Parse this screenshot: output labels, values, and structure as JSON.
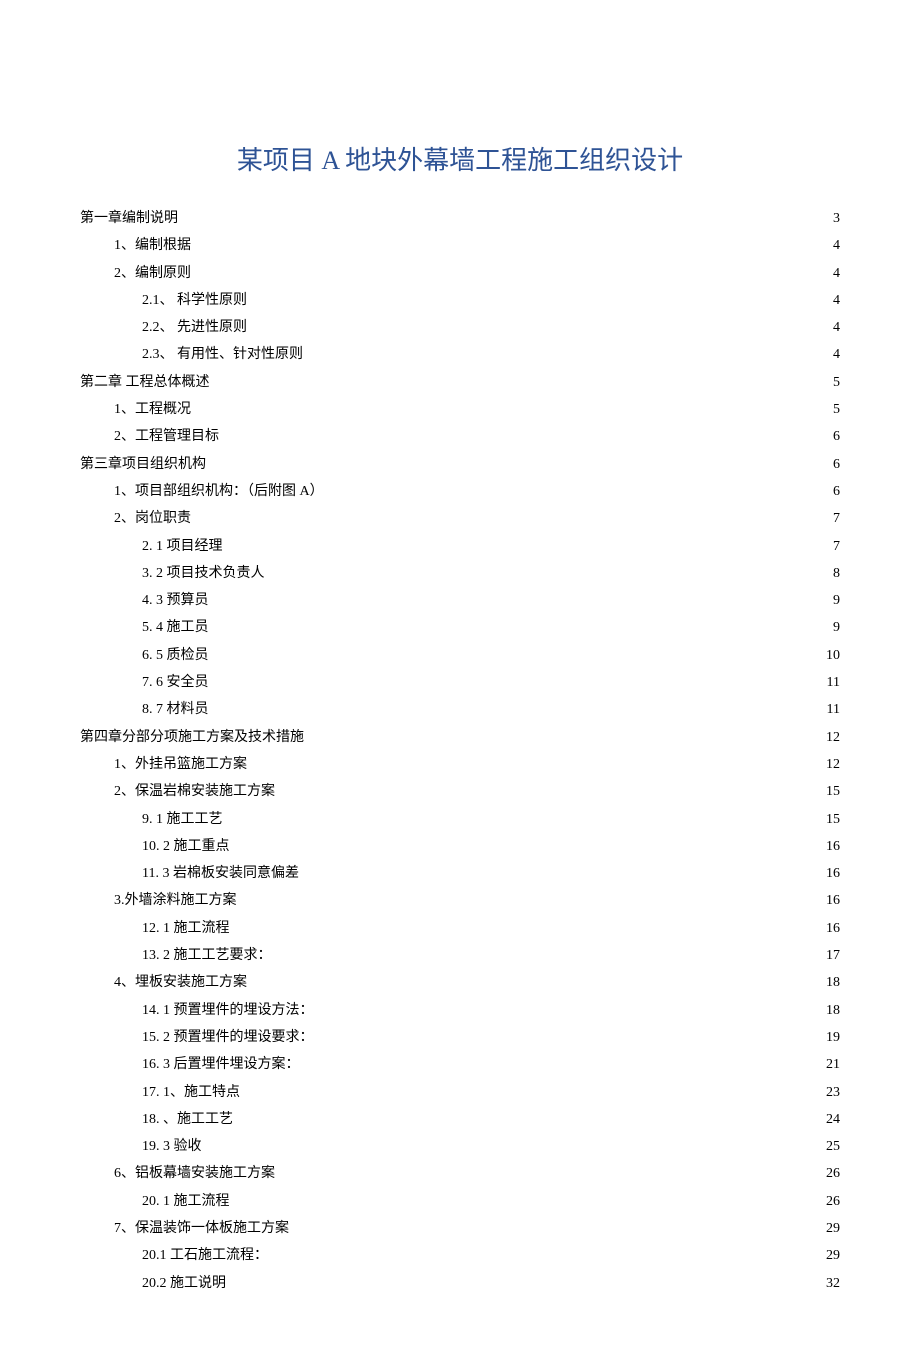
{
  "title": "某项目 A 地块外幕墙工程施工组织设计",
  "toc": [
    {
      "label": "第一章编制说明",
      "page": "3",
      "indent": 0
    },
    {
      "label": "1、编制根据",
      "page": "4",
      "indent": 1
    },
    {
      "label": "2、编制原则",
      "page": "4",
      "indent": 1
    },
    {
      "label": "2.1、  科学性原则",
      "page": "4",
      "indent": 2
    },
    {
      "label": "2.2、  先进性原则",
      "page": "4",
      "indent": 2
    },
    {
      "label": "2.3、  有用性、针对性原则",
      "page": "4",
      "indent": 2
    },
    {
      "label": "第二章   工程总体概述",
      "page": "5",
      "indent": 0
    },
    {
      "label": "1、工程概况",
      "page": "5",
      "indent": 1
    },
    {
      "label": "2、工程管理目标",
      "page": "6",
      "indent": 1
    },
    {
      "label": "第三章项目组织机构",
      "page": "6",
      "indent": 0
    },
    {
      "label": "1、项目部组织机构：（后附图 A）",
      "page": "6",
      "indent": 1
    },
    {
      "label": "2、岗位职责",
      "page": "7",
      "indent": 1
    },
    {
      "label": "2.  1 项目经理",
      "page": "7",
      "indent": 2
    },
    {
      "label": "3.  2 项目技术负责人",
      "page": "8",
      "indent": 2
    },
    {
      "label": "4.  3 预算员",
      "page": "9",
      "indent": 2
    },
    {
      "label": "5.  4 施工员",
      "page": "9",
      "indent": 2
    },
    {
      "label": "6.  5 质检员",
      "page": "10",
      "indent": 2
    },
    {
      "label": "7.  6 安全员",
      "page": "11",
      "indent": 2
    },
    {
      "label": "8.  7 材料员",
      "page": "11",
      "indent": 2
    },
    {
      "label": "第四章分部分项施工方案及技术措施",
      "page": "12",
      "indent": 0
    },
    {
      "label": "1、外挂吊篮施工方案",
      "page": "12",
      "indent": 1
    },
    {
      "label": "2、保温岩棉安装施工方案",
      "page": "15",
      "indent": 1
    },
    {
      "label": "9.  1 施工工艺",
      "page": "15",
      "indent": 2
    },
    {
      "label": "10. 2 施工重点",
      "page": "16",
      "indent": 2
    },
    {
      "label": "11. 3 岩棉板安装同意偏差",
      "page": "16",
      "indent": 2
    },
    {
      "label": "3.外墙涂料施工方案",
      "page": "16",
      "indent": 1
    },
    {
      "label": "12. 1 施工流程",
      "page": "16",
      "indent": 2
    },
    {
      "label": "13. 2 施工工艺要求：",
      "page": "17",
      "indent": 2
    },
    {
      "label": "4、埋板安装施工方案",
      "page": "18",
      "indent": 1
    },
    {
      "label": "14. 1 预置埋件的埋设方法：",
      "page": "18",
      "indent": 2
    },
    {
      "label": "15. 2 预置埋件的埋设要求：",
      "page": "19",
      "indent": 2
    },
    {
      "label": "16. 3 后置埋件埋设方案：",
      "page": "21",
      "indent": 2
    },
    {
      "label": "17. 1、施工特点",
      "page": "23",
      "indent": 2
    },
    {
      "label": "18.   、施工工艺",
      "page": "24",
      "indent": 2
    },
    {
      "label": "19. 3 验收",
      "page": "25",
      "indent": 2
    },
    {
      "label": "6、铝板幕墙安装施工方案",
      "page": "26",
      "indent": 1
    },
    {
      "label": "20. 1 施工流程",
      "page": "26",
      "indent": 2
    },
    {
      "label": "7、保温装饰一体板施工方案",
      "page": "29",
      "indent": 1
    },
    {
      "label": "20.1    工石施工流程：",
      "page": "29",
      "indent": 2
    },
    {
      "label": "20.2   施工说明",
      "page": "32",
      "indent": 2
    }
  ]
}
